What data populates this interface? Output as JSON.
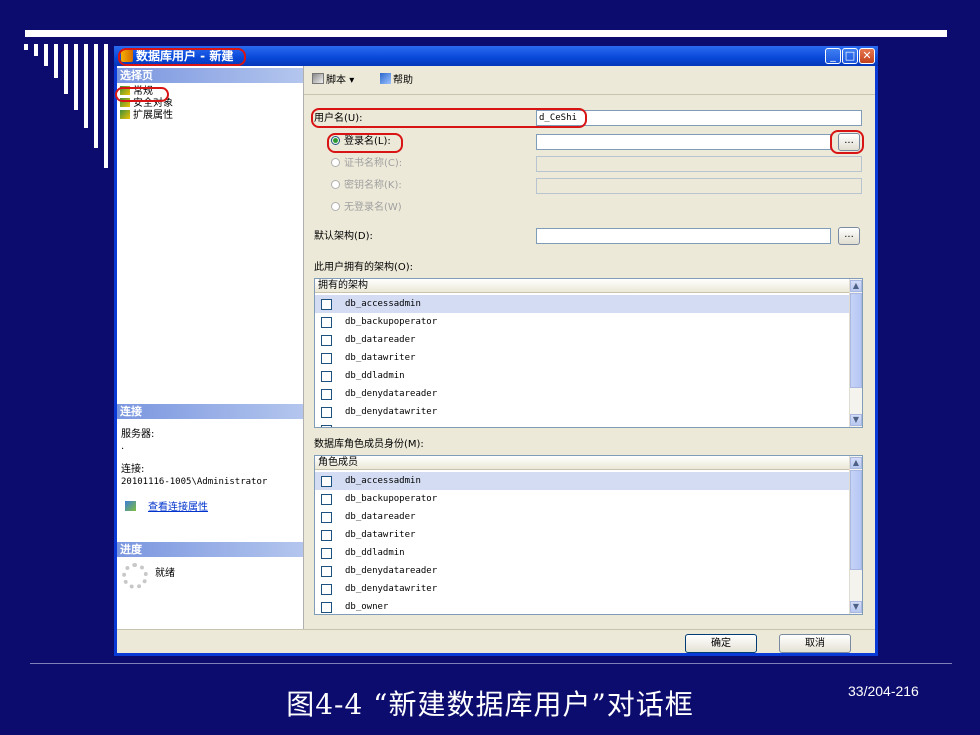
{
  "window": {
    "title": "数据库用户 - 新建",
    "min_label": "_",
    "max_label": "□",
    "close_label": "✕"
  },
  "left": {
    "select_page_header": "选择页",
    "nav_items": [
      "常规",
      "安全对象",
      "扩展属性"
    ],
    "connection_header": "连接",
    "server_label": "服务器:",
    "server_value": ".",
    "connection_label": "连接:",
    "connection_value": "20101116-1005\\Administrator",
    "view_props_link": "查看连接属性",
    "progress_header": "进度",
    "progress_status": "就绪"
  },
  "toolbar": {
    "script_label": "脚本",
    "help_label": "帮助"
  },
  "form": {
    "user_name_label": "用户名(U):",
    "user_name_value": "d_CeShi",
    "login_radio": "登录名(L):",
    "cert_radio": "证书名称(C):",
    "key_radio": "密钥名称(K):",
    "no_login_radio": "无登录名(W)",
    "default_schema_label": "默认架构(D):",
    "browse_label": "..."
  },
  "owned_schemas": {
    "label": "此用户拥有的架构(O):",
    "header": "拥有的架构",
    "rows": [
      "db_accessadmin",
      "db_backupoperator",
      "db_datareader",
      "db_datawriter",
      "db_ddladmin",
      "db_denydatareader",
      "db_denydatawriter"
    ]
  },
  "role_members": {
    "label": "数据库角色成员身份(M):",
    "header": "角色成员",
    "rows": [
      "db_accessadmin",
      "db_backupoperator",
      "db_datareader",
      "db_datawriter",
      "db_ddladmin",
      "db_denydatareader",
      "db_denydatawriter",
      "db_owner"
    ]
  },
  "buttons": {
    "ok": "确定",
    "cancel": "取消"
  },
  "slide": {
    "caption": "图4-4 “新建数据库用户”对话框",
    "page_number": "33/204-216"
  },
  "colors": {
    "slide_bg": "#0c0c6e",
    "highlight": "#d81414",
    "xp_title": "#0848d8",
    "dialog_bg": "#ece9d8"
  }
}
